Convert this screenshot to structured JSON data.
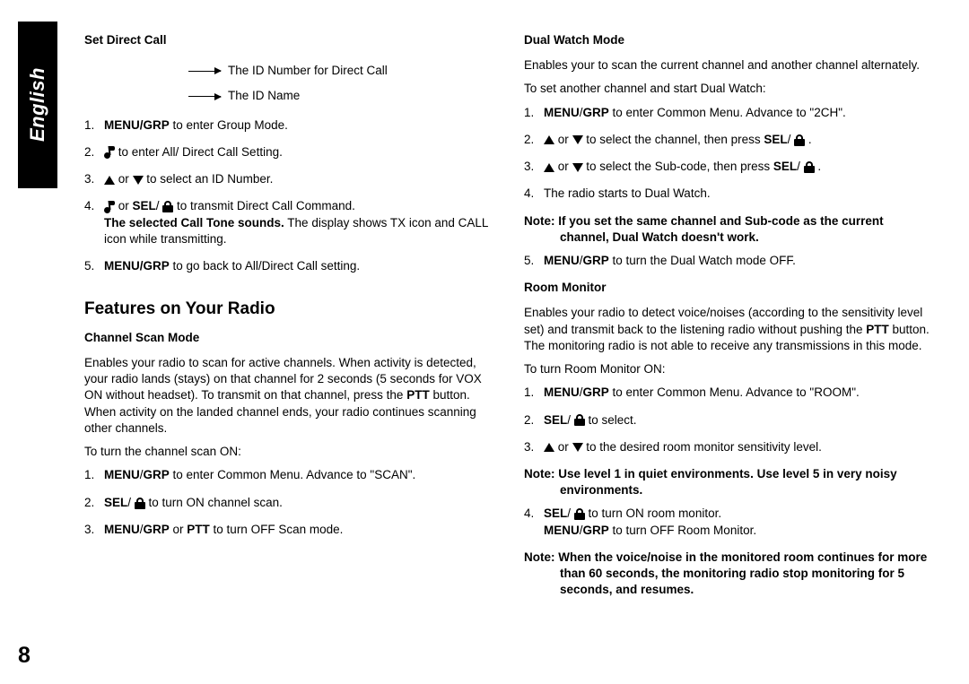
{
  "language_tab": "English",
  "page_number": "8",
  "left": {
    "set_direct_call": {
      "title": "Set Direct Call",
      "diagram": {
        "line1": "The ID Number for Direct Call",
        "line2": "The ID Name"
      },
      "steps": [
        {
          "pre_bold": "MENU/GRP",
          "post": " to enter Group Mode."
        },
        {
          "icon": "note",
          "post": " to enter All/ Direct Call Setting."
        },
        {
          "icons": "updown",
          "mid": " or ",
          "post": " to select an ID Number."
        },
        {
          "icon": "note",
          "mid": " or ",
          "bold2": "SEL",
          "slash": "/ ",
          "icon2": "lock",
          "post": " to transmit Direct Call Command.",
          "extra_bold": "The selected Call Tone sounds.",
          "extra": " The display shows TX icon and CALL icon while transmitting."
        },
        {
          "pre_bold": "MENU/GRP",
          "post": " to go back to All/Direct Call setting."
        }
      ]
    },
    "features_title": "Features on Your Radio",
    "channel_scan": {
      "title": "Channel Scan Mode",
      "intro1": "Enables your radio to scan for active channels. When activity is detected, your radio lands (stays) on that channel for 2 seconds (5 seconds for VOX ON without headset). To transmit on that channel, press the ",
      "intro_bold": "PTT",
      "intro2": " button. When activity on the landed channel ends, your radio continues scanning other channels.",
      "sub": "To turn the channel scan ON:",
      "steps": [
        {
          "pre_bold": "MENU",
          "slash1": "/",
          "pre_bold2": "GRP",
          "post": " to enter Common Menu. Advance to \"SCAN\"."
        },
        {
          "pre_bold": "SEL",
          "slash": "/ ",
          "icon": "lock",
          "post": " to turn ON channel scan."
        },
        {
          "pre_bold": "MENU",
          "slash1": "/",
          "pre_bold2": "GRP",
          "mid": " or ",
          "pre_bold3": "PTT",
          "post": " to turn OFF Scan mode."
        }
      ]
    }
  },
  "right": {
    "dual_watch": {
      "title": "Dual Watch Mode",
      "intro": "Enables your to scan the current channel and another channel alternately.",
      "sub": "To set another channel and start Dual Watch:",
      "steps": [
        {
          "pre_bold": "MENU",
          "slash1": "/",
          "pre_bold2": "GRP",
          "post": " to enter Common Menu. Advance to \"2CH\"."
        },
        {
          "icons": "updown",
          "mid": " or ",
          "post": " to select the channel, then press ",
          "bold_end": "SEL",
          "slash_end": "/ ",
          "icon_end": "lock",
          "period": " ."
        },
        {
          "icons": "updown",
          "mid": " or ",
          "post": " to select the Sub-code, then press ",
          "bold_end": "SEL",
          "slash_end": "/ ",
          "icon_end": "lock",
          "period": " ."
        },
        {
          "plain": "The radio starts to Dual Watch."
        }
      ],
      "note_prefix": "Note: ",
      "note": "If you set the same channel and Sub-code as the current channel, Dual Watch doesn't work.",
      "step5_pre": "MENU",
      "step5_slash": "/",
      "step5_pre2": "GRP",
      "step5_post": " to turn the Dual Watch mode OFF."
    },
    "room_monitor": {
      "title": "Room Monitor",
      "intro1": "Enables your radio to detect voice/noises (according to the sensitivity level set) and transmit back to the listening radio without pushing the ",
      "intro_bold": "PTT",
      "intro2": " button. The monitoring radio is not able to receive any transmissions in this mode.",
      "sub": "To turn Room Monitor ON:",
      "steps": [
        {
          "pre_bold": "MENU",
          "slash1": "/",
          "pre_bold2": "GRP",
          "post": " to enter Common Menu. Advance to \"ROOM\"."
        },
        {
          "pre_bold": "SEL",
          "slash": "/ ",
          "icon": "lock",
          "post": " to select."
        },
        {
          "icons": "updown",
          "mid": " or ",
          "post": " to the desired room monitor sensitivity level."
        }
      ],
      "note1_prefix": "Note: ",
      "note1": "Use level 1 in quiet environments. Use level 5 in very noisy environments.",
      "step4_bold": "SEL",
      "step4_slash": "/ ",
      "step4_post": " to turn ON room monitor.",
      "step4_line2_bold": "MENU",
      "step4_line2_slash": "/",
      "step4_line2_bold2": "GRP",
      "step4_line2_post": " to turn OFF Room Monitor.",
      "note2_prefix": "Note: ",
      "note2": "When the voice/noise in the monitored room continues for more than 60 seconds, the monitoring radio stop monitoring for 5 seconds, and resumes."
    }
  }
}
